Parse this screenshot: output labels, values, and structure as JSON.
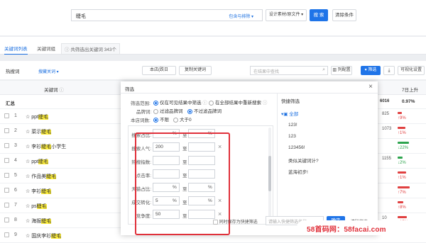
{
  "search": {
    "value": "睫毛",
    "match_label": "包含与排除 ▾",
    "file_btn": "设计素材/原文件 ▾",
    "search_btn": "搜 索",
    "clear_btn": "清除条件"
  },
  "tabs": [
    "关键词列表",
    "关键词组"
  ],
  "result_count": "共筛选出关键词 343个",
  "toolbar": {
    "left_label": "热搜词",
    "dropdown": "搜藏关词 ▾",
    "filter_btn": "本店(跌日",
    "copy_btn": "复制关键词",
    "search_placeholder": "在结果中查找",
    "col_config_btn": "列配置",
    "screen_btn": "筛选",
    "visual_btn": "可视化设置"
  },
  "table": {
    "header_kw": "关键词",
    "header_growth": "7日上升",
    "summary_label": "汇总",
    "summary_num": "6016",
    "summary_pct": "0.97%"
  },
  "rows": [
    {
      "idx": "1",
      "pre": "☆ ppt",
      "hl": "睫毛",
      "post": "",
      "num": "825",
      "trend": "↑9%",
      "trend_color": "#e04040"
    },
    {
      "idx": "2",
      "pre": "☆ 菜示",
      "hl": "睫毛",
      "post": "",
      "num": "1073",
      "trend": "↑1%",
      "trend_color": "#e04040"
    },
    {
      "idx": "3",
      "pre": "☆ 李衫",
      "hl": "睫毛",
      "post": "小学生",
      "num": "",
      "trend": "↓22%",
      "trend_color": "#2da44e"
    },
    {
      "idx": "4",
      "pre": "☆ ppt",
      "hl": "睫毛",
      "post": "",
      "num": "1155",
      "trend": "↓2%",
      "trend_color": "#2da44e"
    },
    {
      "idx": "5",
      "pre": "☆ 作品美",
      "hl": "睫毛",
      "post": "",
      "num": "",
      "trend": "↑1%",
      "trend_color": "#e04040"
    },
    {
      "idx": "6",
      "pre": "☆ 李衫",
      "hl": "睫毛",
      "post": "",
      "num": "",
      "trend": "↑7%",
      "trend_color": "#e04040"
    },
    {
      "idx": "7",
      "pre": "☆ ps",
      "hl": "睫毛",
      "post": "",
      "num": "",
      "trend": "↑8%",
      "trend_color": "#e04040"
    },
    {
      "idx": "8",
      "pre": "☆ 海报",
      "hl": "睫毛",
      "post": "",
      "num": "10",
      "trend": "↑15%",
      "trend_color": "#e04040"
    },
    {
      "idx": "9",
      "pre": "☆ 国庆李衫",
      "hl": "睫毛",
      "post": "",
      "num": "",
      "trend": "",
      "trend_color": "#e04040"
    }
  ],
  "modal": {
    "title": "筛选",
    "close": "×",
    "scope_label": "筛选范围:",
    "scope_opt1": "仅在可见结果中筛选",
    "scope_opt2": "在全部结果中重新搜索",
    "dedupe_label": "品牌词:",
    "dedupe_opt1": "过滤品牌词",
    "dedupe_opt2": "不过滤品牌词",
    "count_label": "本店词数:",
    "count_opt1": "不限",
    "count_opt2": "大于0",
    "fields": [
      {
        "label": "搜索占比:",
        "v1": "",
        "u1": "%",
        "v2": "",
        "u2": "%",
        "x": false
      },
      {
        "label": "搜索人气:",
        "v1": "200",
        "u1": "",
        "v2": "",
        "u2": "",
        "x": true
      },
      {
        "label": "热搜指数:",
        "v1": "",
        "u1": "",
        "v2": "",
        "u2": "",
        "x": false
      },
      {
        "label": "点击率:",
        "v1": "",
        "u1": "",
        "v2": "",
        "u2": "",
        "x": false
      },
      {
        "label": "天猫占比:",
        "v1": "",
        "u1": "%",
        "v2": "",
        "u2": "%",
        "x": false
      },
      {
        "label": "成交转化:",
        "v1": "5",
        "u1": "%",
        "v2": "",
        "u2": "%",
        "x": true
      },
      {
        "label": "竞争度:",
        "v1": "50",
        "u1": "",
        "v2": "",
        "u2": "",
        "x": true
      }
    ],
    "to_label": "至",
    "quick_title": "快捷筛选",
    "quick_all": "全部",
    "quick_items": [
      "123!",
      "123",
      "123456!",
      "类似关键词计?",
      "蓝海初步!"
    ],
    "save_checkbox": "同时保存为快捷筛选",
    "name_placeholder": "请输入快捷筛选名称",
    "ok_btn": "确定",
    "clear_btn": "清除筛选"
  },
  "watermark": "58首码网：58facai.com"
}
